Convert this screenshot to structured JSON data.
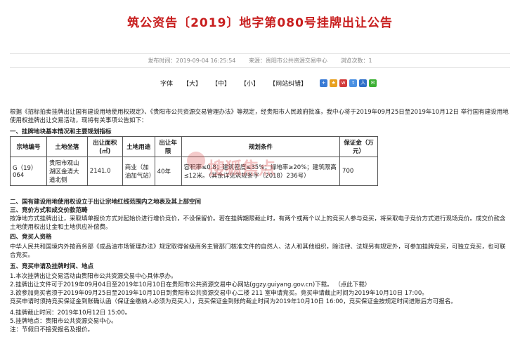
{
  "title": "筑公资告〔2019〕地字第080号挂牌出让公告",
  "meta": {
    "publish_time": "发布时间：2019-09-04 16:25:54",
    "source": "来源：贵阳市公共资源交易中心",
    "views": "浏览次数：1"
  },
  "toolbar": {
    "font_label": "字体",
    "large": "【大】",
    "medium": "【中】",
    "small": "【小】",
    "correction": "【网站纠错】"
  },
  "intro": "根据《招标拍卖挂牌出让国有建设用地使用权规定》、《贵阳市公共资源交易管理办法》等规定，经贵阳市人民政府批准，我中心将于2019年09月25日至2019年10月12日 举行国有建设用地使用权挂牌出让交易活动，现将有关事项公告如下：",
  "section1": "一、挂牌地块基本情况和主要规划指标",
  "table": {
    "headers": [
      "宗地编号",
      "土地坐落",
      "出让面积(㎡)",
      "土地用途",
      "出让年限",
      "规划条件",
      "保证金（万元）"
    ],
    "rows": [
      [
        "G（19）064",
        "贵阳市观山湖区金清大道北侧",
        "2141.0",
        "商业（加油加气站）",
        "40年",
        "容积率≤0.8；建筑密度≤35%；绿地率≥20%；建筑限高≤12米。（其余详见筑规条字（2018）236号）",
        "700"
      ]
    ]
  },
  "watermark": "搜狐焦点",
  "section2": "二、国有建设用地使用权设立于出让宗地红线范围内之地表及其上部空间",
  "section3": "三、竞价方式和成交价款范畴",
  "section3_text": "按净地方式挂牌出让，采取填单报价方式对起始价进行增价竞价，不设保留价。若在挂牌期限截止时，有两个或两个以上的竞买人参与竞买，将采取电子竞价方式进行现场竞价。成交价款含土地使用权出让金和土地供应补偿费。",
  "section4": "四、竞买人资格",
  "section4_text": "中华人民共和国境内外按商务部《成品油市场管理办法》规定取得省级商务主管部门核准文件的自然人、法人和其他组织，除法律、法规另有规定外，可参加挂牌竞买，可独立竞买，也可联合竞买。",
  "section5": "五、竞买申请及挂牌时间、地点",
  "items": [
    "1.本次挂牌出让交易活动由贵阳市公共资源交易中心具体承办。",
    "2.挂牌出让文件可于2019年09月04日至2019年10月10日在贵阳市公共资源交易中心网站(ggzy.guiyang.gov.cn)下载。 （点此下载）",
    "3.欲参加竞买者须于2019年09月25日至2019年10月10日到贵阳市公共资源交易中心二楼 211 室申请竞买。竞买申请截止时间为2019年10月10日 17:00。",
    "竞买申请时须持竞买保证金到账确认函（保证金缴纳人必须为竞买人），竞买保证金到账的截止时间为2019年10月10日 16:00，竞买保证金按规定时间进账后方可报名。",
    "4.挂牌截止时间：2019年10月12日 15:00。",
    "5.挂牌地点：贵阳市公共资源交易中心。",
    "注：节假日不接受报名及报价。"
  ]
}
